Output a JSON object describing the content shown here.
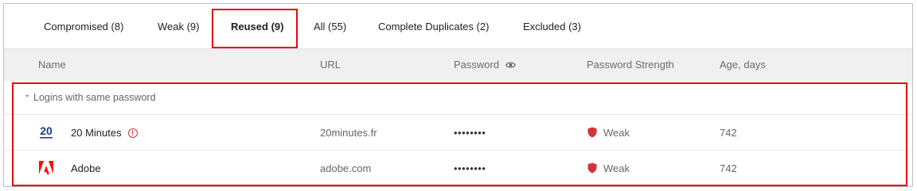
{
  "tabs": [
    {
      "label": "Compromised (8)"
    },
    {
      "label": "Weak (9)"
    },
    {
      "label": "Reused (9)"
    },
    {
      "label": "All (55)"
    },
    {
      "label": "Complete Duplicates (2)"
    },
    {
      "label": "Excluded (3)"
    }
  ],
  "active_tab": "Reused (9)",
  "columns": {
    "name": "Name",
    "url": "URL",
    "password": "Password",
    "strength": "Password Strength",
    "age": "Age, days"
  },
  "group": {
    "label": "Logins with same password",
    "icon": "chevron-down-icon"
  },
  "rows": [
    {
      "name": "20 Minutes",
      "url": "20minutes.fr",
      "password": "••••••••",
      "strength": "Weak",
      "age": "742",
      "logo_text": "20",
      "logo_color": "#1a3a8c",
      "has_alert": true
    },
    {
      "name": "Adobe",
      "url": "adobe.com",
      "password": "••••••••",
      "strength": "Weak",
      "age": "742",
      "logo_color": "#fa0f00",
      "has_alert": false
    }
  ],
  "colors": {
    "highlight": "#e30613",
    "weak_shield": "#d13438",
    "header_bg": "#f0f0f0"
  }
}
